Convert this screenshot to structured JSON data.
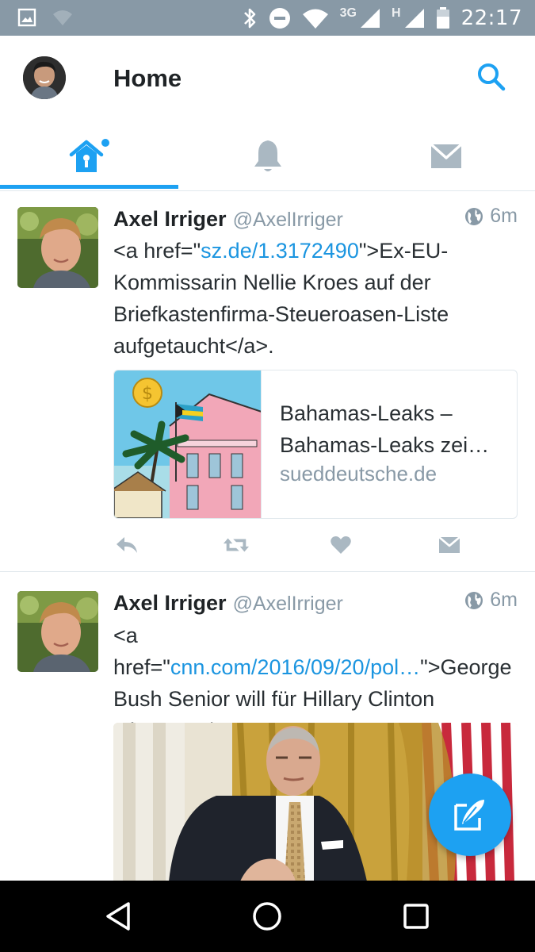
{
  "status_bar": {
    "network_label_1": "3G",
    "network_label_2": "H",
    "time": "22:17",
    "icons": [
      "gallery-icon",
      "wifi-off-icon",
      "bluetooth-icon",
      "dnd-icon",
      "wifi-icon",
      "signal-icon",
      "signal-icon",
      "battery-icon"
    ]
  },
  "header": {
    "title": "Home"
  },
  "tabs": [
    {
      "name": "home",
      "icon": "home-icon",
      "active": true,
      "has_unread_dot": true
    },
    {
      "name": "notifications",
      "icon": "bell-icon",
      "active": false
    },
    {
      "name": "messages",
      "icon": "mail-icon",
      "active": false
    }
  ],
  "tweets": [
    {
      "author_name": "Axel Irriger",
      "author_handle": "@AxelIrriger",
      "time": "6m",
      "text_before_link": "<a href=\"",
      "link_text": "sz.de/1.3172490",
      "text_after_link": "\">Ex-EU-Kommissarin Nellie Kroes auf der Briefkastenfirma-Steueroasen-Liste aufgetaucht</a>.",
      "card": {
        "title_line_1": "Bahamas-Leaks –",
        "title_line_2": "Bahamas-Leaks zei…",
        "domain": "sueddeutsche.de"
      }
    },
    {
      "author_name": "Axel Irriger",
      "author_handle": "@AxelIrriger",
      "time": "6m",
      "text_before_link": "<a href=\"",
      "link_text": "cnn.com/2016/09/20/pol…",
      "text_after_link": "\">George Bush Senior will für Hillary Clinton stimmen</a>. V"
    }
  ],
  "colors": {
    "accent": "#1da1f2",
    "link": "#1b95e0",
    "status_bar": "#8899a6",
    "muted": "#8899a6",
    "icon_gray": "#aab8c2"
  }
}
